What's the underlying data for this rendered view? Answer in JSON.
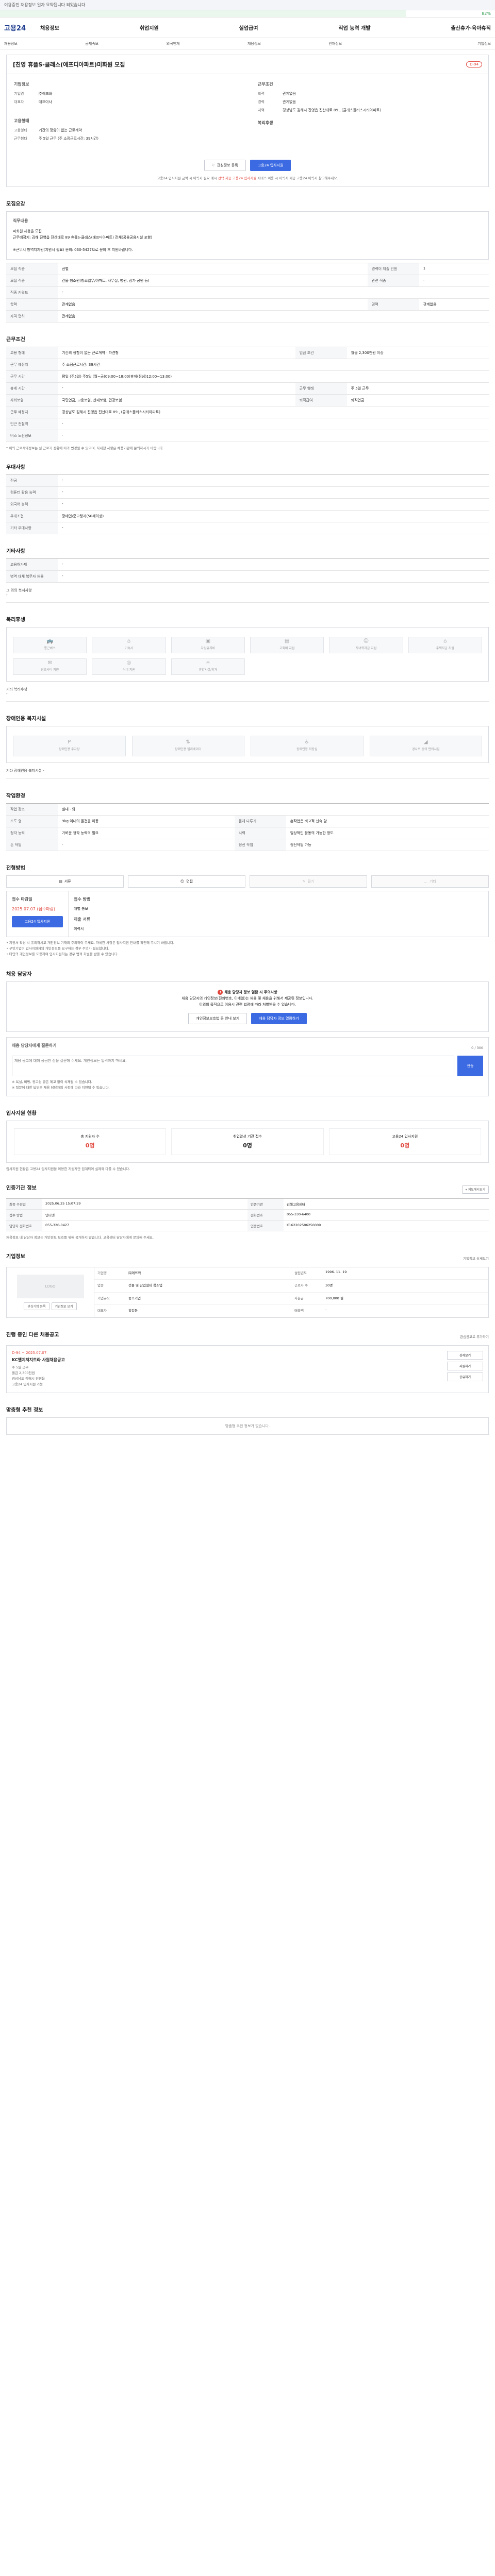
{
  "topbar": {
    "text": "이용중인 채용정보 일자 요약됩니다 되었습니다"
  },
  "progress": {
    "fraction": 0.82,
    "label": "82%"
  },
  "logo": "고용24",
  "gnb": [
    "채용정보",
    "취업지원",
    "실업급여",
    "직업 능력 개발",
    "출산휴가·육아휴직"
  ],
  "subnav": [
    "채용정보",
    "공채속보",
    "외국인채",
    "채용정보",
    "인재정보",
    "기업정보"
  ],
  "job": {
    "title": "[친영 휴플S-클래스(에프디아파트)미화원 모집",
    "badge": "D-94",
    "company_h": "기업정보",
    "company_k": "기업명",
    "company_v": "㈜에뜨와",
    "ceo_k": "대표자",
    "ceo_v": "대표이사",
    "cond_h": "근무조건",
    "edu_k": "학력",
    "edu_v": "관계없음",
    "career_k": "경력",
    "career_v": "관계없음",
    "addr_k": "지역",
    "addr_v": "경상남도 김해시 진영읍 진산대로 89 ,  (클래스플러스시티아파트)",
    "emp_h": "고용형태",
    "emp_k": "고용형태",
    "emp_v": "기간의 정함이 없는 근로계약",
    "time_k": "근무형태",
    "time_v": "주 5일 근무 (주 소정근로시간: 39시간)",
    "pay_h": "복리후생",
    "fav_btn": "관심정보 등록",
    "apply_btn": "고용24 입사지원",
    "note": "고용24 입사지원 금액 시 이력서 필요 메시 ",
    "note_red": "선택 제공 고용24 입사지원",
    "note_tail": " 서비스 이용 시 이력서 제공 고용24 이력서 참고해주세요."
  },
  "recruit": {
    "title": "모집요강",
    "duties_h": "직무내용",
    "duties": [
      "미화원 채용을 모집",
      "근무예정지: 김해 진영읍 진산대로 89 휴플S-클래스(에프디아파트) 전체(공용공용시설 포함)",
      "",
      "※근무시 방역지지원(지원서 필요) 문의: 030-5427으로 문의 후 지원바랍니다."
    ],
    "rows": [
      [
        "모집 직종",
        "선별",
        "경력이 제출 인원",
        "1"
      ],
      [
        "모집 직종",
        "건물 청소원(청소업무/아파트, 사무실, 병원, 상가 공원 등)",
        "관련 직종",
        "-"
      ],
      [
        "직종 키워드",
        "-",
        "",
        ""
      ],
      [
        "학력",
        "관계없음",
        "경력",
        "관계없음"
      ],
      [
        "자격 면허",
        "관계없음",
        "",
        ""
      ]
    ]
  },
  "work": {
    "title": "근무조건",
    "rows": [
      [
        "고용 형태",
        "기간의 정함이 없는 근로계약 · 파견형",
        "임금 조건",
        "월급 2,300천원 이상"
      ],
      [
        "근무 예정지",
        "주 소정근로시간: 39시간",
        "",
        " "
      ],
      [
        "근무 시간",
        "평일 (주5일) 주5일 (월~금)09:00~18:00(휴게(점심)12:00~13:00)",
        "",
        ""
      ],
      [
        "휴게 시간",
        "-",
        "근무 형태",
        "주 5일 근무"
      ],
      [
        "사회보험",
        "국민연금, 고용보험, 산재보험, 건강보험",
        "퇴직급여",
        "퇴직연금"
      ],
      [
        "근무 예정지",
        "경상남도 김해시 진영읍 진산대로 89 ,  (클래스플러스시티아파트)",
        "",
        ""
      ],
      [
        "인근 전철역",
        "-",
        "",
        ""
      ],
      [
        "버스 노선정보",
        "-",
        "",
        ""
      ]
    ],
    "footnote": "* 위의 근로계약정보는 실 근로기 상황에 따라 변경될 수 있으며, 자세한 사항은 채용기관에 문의하시기 바랍니다."
  },
  "extra": {
    "title": "우대사항",
    "rows": [
      [
        "전공",
        "-"
      ],
      [
        "컴퓨터 활용 능력",
        "-"
      ],
      [
        "외국어 능력",
        "-"
      ],
      [
        "우대조건",
        "장애인/준고령자(50세이상)"
      ],
      [
        "기타 우대사항",
        "-"
      ]
    ]
  },
  "other": {
    "title": "기타사항",
    "rows": [
      [
        "고용허가제",
        "-"
      ],
      [
        "병역 대체 복무자 채용",
        "-"
      ]
    ],
    "etc_h": "그 외의 복지사항",
    "etc_v": "-"
  },
  "welfare": {
    "title": "복리후생",
    "items": [
      "통근버스",
      "기숙사",
      "차량유지비",
      "교육비 지원",
      "자녀학자금 지원",
      "주택자금 지원",
      "경조사비 지원",
      "식비 지원",
      "휴양시설/휴가"
    ],
    "other_h": "기타 복리후생",
    "other_v": "-"
  },
  "disability": {
    "title": "장애인용 복지시설",
    "items": [
      "장애인용 주차장",
      "장애인용 엘리베이터",
      "장애인용 화장실",
      "경사로 등의 편의시설"
    ],
    "other": "기타 장애인용 복지시설 -"
  },
  "env": {
    "title": "작업환경",
    "rows": [
      [
        "작업 장소",
        "실내 · 외",
        "",
        ""
      ],
      [
        "조도 형",
        "9kg 이내의 물건을 이동",
        "물체 다루기",
        "손작업은 비교적 신속 함"
      ],
      [
        "청각 능력",
        "가벼운 청각 능력의 필요",
        "시력",
        "일상적인 활동의 가능한 정도"
      ],
      [
        "손 작업",
        "-",
        "정신 작업",
        "정신작업 가능"
      ]
    ]
  },
  "process": {
    "title": "전형방법",
    "methods": [
      "서류",
      "면접",
      "필기",
      "기타"
    ],
    "receive_h": "접수 마감일",
    "receive_date": "2025.07.07 (접수마감)",
    "receive_btn": "고용24 입사지원",
    "method_h": "접수 방법",
    "method_v": "개별 통보",
    "doc_h": "제출 서류",
    "doc_v": "이력서",
    "notes": [
      "• 지원서 작성 시 유의하시고 개인정보 기재의 주의하여 주세요. 자세한 사항은 입사지원 안내를 확인해 주시기 바랍니다.",
      "• 구인기업이 입사지원자의 개인정보를 요구하는 경우 주의가 필요합니다.",
      "• 타인의 개인정보를 도용하여 입사지원하는 경우 법적 처벌을 받을 수 있습니다."
    ]
  },
  "contact": {
    "title": "채용 담당자",
    "warn": "채용 담당자 정보 열람 시 주의사항",
    "desc": "채용 담당자의 개인정보(전화번호, 이메일)는 채용 및 채용을 위해서 제공된 정보입니다.",
    "desc2": "이외의 목적으로 이용시 관련 법령에 따라 처벌받을 수 있습니다.",
    "btn1": "개인정보보호법 등 안내 보기",
    "btn2": "채용 담당자 정보 열람하기"
  },
  "qna": {
    "title": "채용 담당자에게 질문하기",
    "count": "0 / 300",
    "placeholder": "채용 공고에 대해 궁금한 점을 질문해 주세요. 개인정보는 입력하지 마세요.",
    "send": "전송",
    "notes": [
      "※ 욕설, 비방, 광고성 글은 예고 없이 삭제될 수 있습니다.",
      "※ 질문에 대한 답변은 채용 담당자의 사정에 따라 지연될 수 있습니다."
    ]
  },
  "status": {
    "title": "입사지원 현황",
    "items": [
      [
        "총 지원자 수",
        "0명"
      ],
      [
        "취업알선 기관 접수",
        "0명"
      ],
      [
        "고용24 입사지원",
        "0명"
      ]
    ],
    "note": "입사지원 현황은 고용24 입사지원을 이용한 지원자만 집계되어 실제와 다를 수 있습니다."
  },
  "agency": {
    "title": "인증기관 정보",
    "map": "지도에서보기",
    "rows": [
      [
        "최종 수정일",
        "2025.06.25 15:07:29",
        "인증기관",
        "김해고용센터"
      ],
      [
        "접수 방법",
        "인터넷",
        "전화번호",
        "055-330-6400"
      ],
      [
        "담당자 전화번호",
        "055-320-0427",
        "인증번호",
        "K162202506250009"
      ]
    ],
    "note": "채용정보 내 담당자 정보는 개인정보 보호를 위해 공개하지 않습니다. 고용센터 담당자에게 문의해 주세요."
  },
  "companyinfo": {
    "title": "기업정보",
    "detail": "기업정보 상세보기",
    "logo": "LOGO",
    "btn1": "관심기업 등록",
    "btn2": "기업정보 보기",
    "rows": [
      [
        "기업명",
        "㈜에뜨와",
        "설립년도",
        "1996. 11. 19"
      ],
      [
        "업종",
        "건물 및 산업설비 청소업",
        "근로자 수",
        "30명"
      ],
      [
        "기업규모",
        "중소기업",
        "자본금",
        "700,000 원"
      ],
      [
        "대표자",
        "홍길동",
        "매출액",
        "-"
      ]
    ]
  },
  "related": {
    "title": "진행 중인 다른 채용공고",
    "more": "관심공고로 추가하기",
    "date": "D-94 ~ 2025.07.07",
    "name": "KC엘지저지트라 사원채용공고",
    "lines": [
      "주 5일 근무",
      "월급 2,300천원",
      "경상남도 김해시 진영읍",
      "고용24 입사지원 가능"
    ],
    "btns": [
      "상세보기",
      "지원하기",
      "공유하기"
    ]
  },
  "ai": {
    "title": "맞춤형 추천 정보",
    "empty": "맞춤형 추천 정보가 없습니다."
  }
}
